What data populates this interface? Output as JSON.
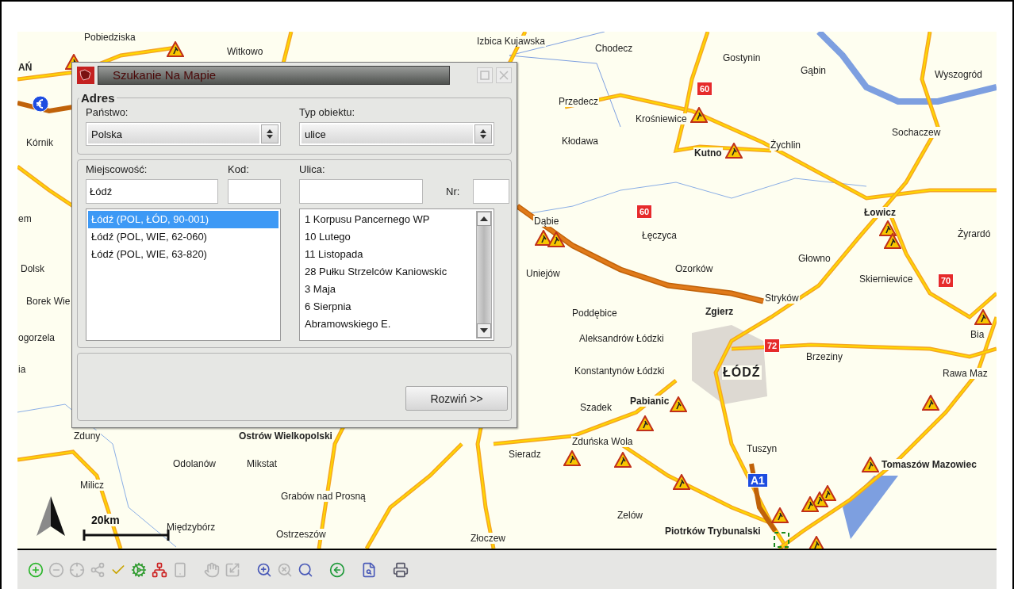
{
  "map": {
    "places": [
      {
        "name": "Pobiedziska",
        "kind": "town"
      },
      {
        "name": "Witkowo",
        "kind": "town"
      },
      {
        "name": "Izbica Kujawska",
        "kind": "town"
      },
      {
        "name": "Chodecz",
        "kind": "town"
      },
      {
        "name": "Gostynin",
        "kind": "town"
      },
      {
        "name": "AŃ",
        "kind": "city"
      },
      {
        "name": "Gąbin",
        "kind": "town"
      },
      {
        "name": "Wyszogród",
        "kind": "town"
      },
      {
        "name": "Przedecz",
        "kind": "town"
      },
      {
        "name": "Krośniewice",
        "kind": "town"
      },
      {
        "name": "Sochaczew",
        "kind": "town"
      },
      {
        "name": "Kórnik",
        "kind": "town"
      },
      {
        "name": "Kłodawa",
        "kind": "town"
      },
      {
        "name": "Żychlin",
        "kind": "town"
      },
      {
        "name": "Kutno",
        "kind": "city"
      },
      {
        "name": "em",
        "kind": "town"
      },
      {
        "name": "Dąbie",
        "kind": "town"
      },
      {
        "name": "Łowicz",
        "kind": "city"
      },
      {
        "name": "Łęczyca",
        "kind": "town"
      },
      {
        "name": "Żyrardó",
        "kind": "town"
      },
      {
        "name": "Głowno",
        "kind": "town"
      },
      {
        "name": "Dolsk",
        "kind": "town"
      },
      {
        "name": "Uniejów",
        "kind": "town"
      },
      {
        "name": "Ozorków",
        "kind": "town"
      },
      {
        "name": "Skierniewice",
        "kind": "town"
      },
      {
        "name": "Borek Wie",
        "kind": "town"
      },
      {
        "name": "Stryków",
        "kind": "town"
      },
      {
        "name": "Poddębice",
        "kind": "town"
      },
      {
        "name": "Zgierz",
        "kind": "city"
      },
      {
        "name": "ogorzela",
        "kind": "town"
      },
      {
        "name": "Aleksandrów Łódzki",
        "kind": "town"
      },
      {
        "name": "Bia",
        "kind": "town"
      },
      {
        "name": "Brzeziny",
        "kind": "town"
      },
      {
        "name": "ia",
        "kind": "town"
      },
      {
        "name": "Konstantynów Łódzki",
        "kind": "town"
      },
      {
        "name": "ŁÓDŹ",
        "kind": "capital"
      },
      {
        "name": "Rawa Maz",
        "kind": "town"
      },
      {
        "name": "Szadek",
        "kind": "town"
      },
      {
        "name": "Pabianic",
        "kind": "city"
      },
      {
        "name": "Zduny",
        "kind": "town"
      },
      {
        "name": "Ostrów Wielkopolski",
        "kind": "city"
      },
      {
        "name": "Zduńska Wola",
        "kind": "town"
      },
      {
        "name": "Sieradz",
        "kind": "town"
      },
      {
        "name": "Tuszyn",
        "kind": "town"
      },
      {
        "name": "Odolanów",
        "kind": "town"
      },
      {
        "name": "Mikstat",
        "kind": "town"
      },
      {
        "name": "Tomaszów Mazowiec",
        "kind": "city"
      },
      {
        "name": "Milicz",
        "kind": "town"
      },
      {
        "name": "Grabów nad Prosną",
        "kind": "town"
      },
      {
        "name": "Zelów",
        "kind": "town"
      },
      {
        "name": "Międzybórz",
        "kind": "town"
      },
      {
        "name": "Ostrzeszów",
        "kind": "town"
      },
      {
        "name": "Złoczew",
        "kind": "town"
      },
      {
        "name": "Piotrków Trybunalski",
        "kind": "city"
      }
    ],
    "road_badges": [
      {
        "label": "60",
        "kind": "national"
      },
      {
        "label": "60",
        "kind": "national"
      },
      {
        "label": "70",
        "kind": "national"
      },
      {
        "label": "72",
        "kind": "national"
      },
      {
        "label": "A1",
        "kind": "motorway"
      }
    ],
    "scale": "20km"
  },
  "dialog": {
    "title": "Szukanie Na Mapie",
    "group_label": "Adres",
    "country_label": "Państwo:",
    "country_value": "Polska",
    "type_label": "Typ obiektu:",
    "type_value": "ulice",
    "city_label": "Miejscowość:",
    "city_value": "Łódź",
    "code_label": "Kod:",
    "street_label": "Ulica:",
    "number_label": "Nr:",
    "cities": [
      {
        "text": "Łódź (POL, ŁÓD, 90-001)",
        "selected": true
      },
      {
        "text": "Łódź (POL, WIE, 62-060)",
        "selected": false
      },
      {
        "text": "Łódź (POL, WIE, 63-820)",
        "selected": false
      }
    ],
    "streets": [
      {
        "text": "1 Korpusu Pancernego WP",
        "selected": false
      },
      {
        "text": "10 Lutego",
        "selected": false
      },
      {
        "text": "11 Listopada",
        "selected": false
      },
      {
        "text": "28 Pułku Strzelców Kaniowskic",
        "selected": false
      },
      {
        "text": "3 Maja",
        "selected": false
      },
      {
        "text": "6 Sierpnia",
        "selected": false
      },
      {
        "text": "Abramowskiego E.",
        "selected": false
      }
    ],
    "expand_button": "Rozwiń >>"
  },
  "toolbar": {
    "tools": [
      {
        "kind": "add",
        "disabled": false
      },
      {
        "kind": "remove",
        "disabled": true
      },
      {
        "kind": "crosshair",
        "disabled": true
      },
      {
        "kind": "nodes",
        "disabled": true
      },
      {
        "kind": "check",
        "disabled": false
      },
      {
        "kind": "gear",
        "disabled": false
      },
      {
        "kind": "tree",
        "disabled": false
      },
      {
        "kind": "device",
        "disabled": true
      },
      {
        "kind": "hand",
        "disabled": true
      },
      {
        "kind": "frame",
        "disabled": true
      },
      {
        "kind": "zoom",
        "disabled": false
      },
      {
        "kind": "crossed",
        "disabled": true
      },
      {
        "kind": "search",
        "disabled": false
      },
      {
        "kind": "back",
        "disabled": false
      },
      {
        "kind": "preview",
        "disabled": false
      },
      {
        "kind": "printer",
        "disabled": false
      }
    ]
  }
}
